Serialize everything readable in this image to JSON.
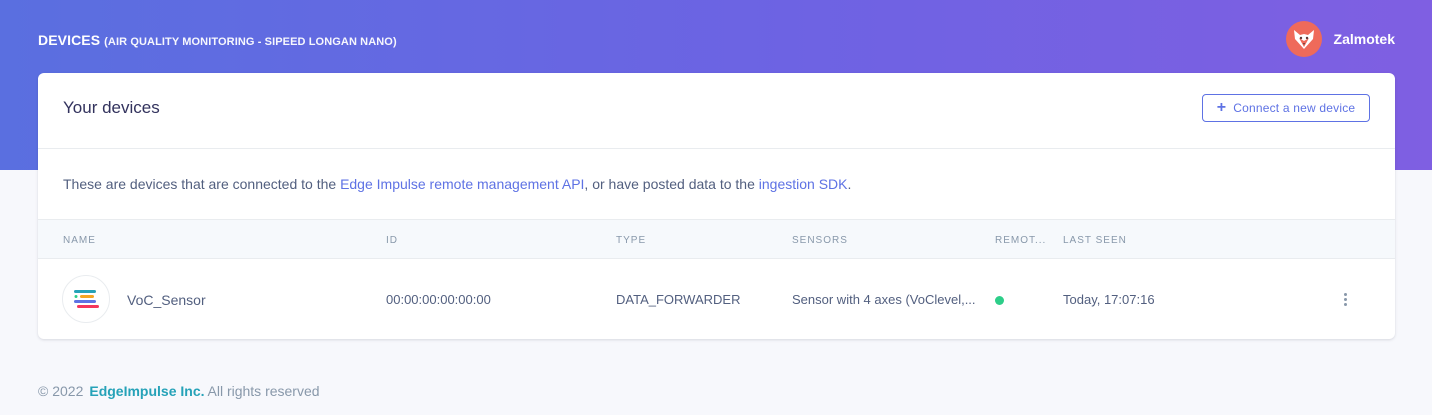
{
  "header": {
    "title": "DEVICES",
    "subtitle": "(AIR QUALITY MONITORING - SIPEED LONGAN NANO)",
    "user_name": "Zalmotek",
    "avatar_icon": "fox-avatar-icon",
    "gradient_start": "#5a6fe0",
    "gradient_end": "#7f5fe2"
  },
  "card": {
    "title": "Your devices",
    "connect_button": "Connect a new device",
    "connect_icon": "plus-icon",
    "intro": {
      "text1": "These are devices that are connected to the ",
      "link1": "Edge Impulse remote management API",
      "text2": ", or have posted data to the ",
      "link2": "ingestion SDK",
      "text3": "."
    }
  },
  "table": {
    "columns": [
      "NAME",
      "ID",
      "TYPE",
      "SENSORS",
      "REMOT...",
      "LAST SEEN"
    ],
    "rows": [
      {
        "name": "VoC_Sensor",
        "id": "00:00:00:00:00:00",
        "type": "DATA_FORWARDER",
        "sensors": "Sensor with 4 axes (VoClevel,...",
        "remote_status": "online",
        "remote_color": "#2dce89",
        "last_seen": "Today, 17:07:16",
        "icon": "data-forwarder-icon"
      }
    ]
  },
  "footer": {
    "copyright": "© 2022",
    "company": "EdgeImpulse Inc.",
    "rights": "All rights reserved"
  }
}
